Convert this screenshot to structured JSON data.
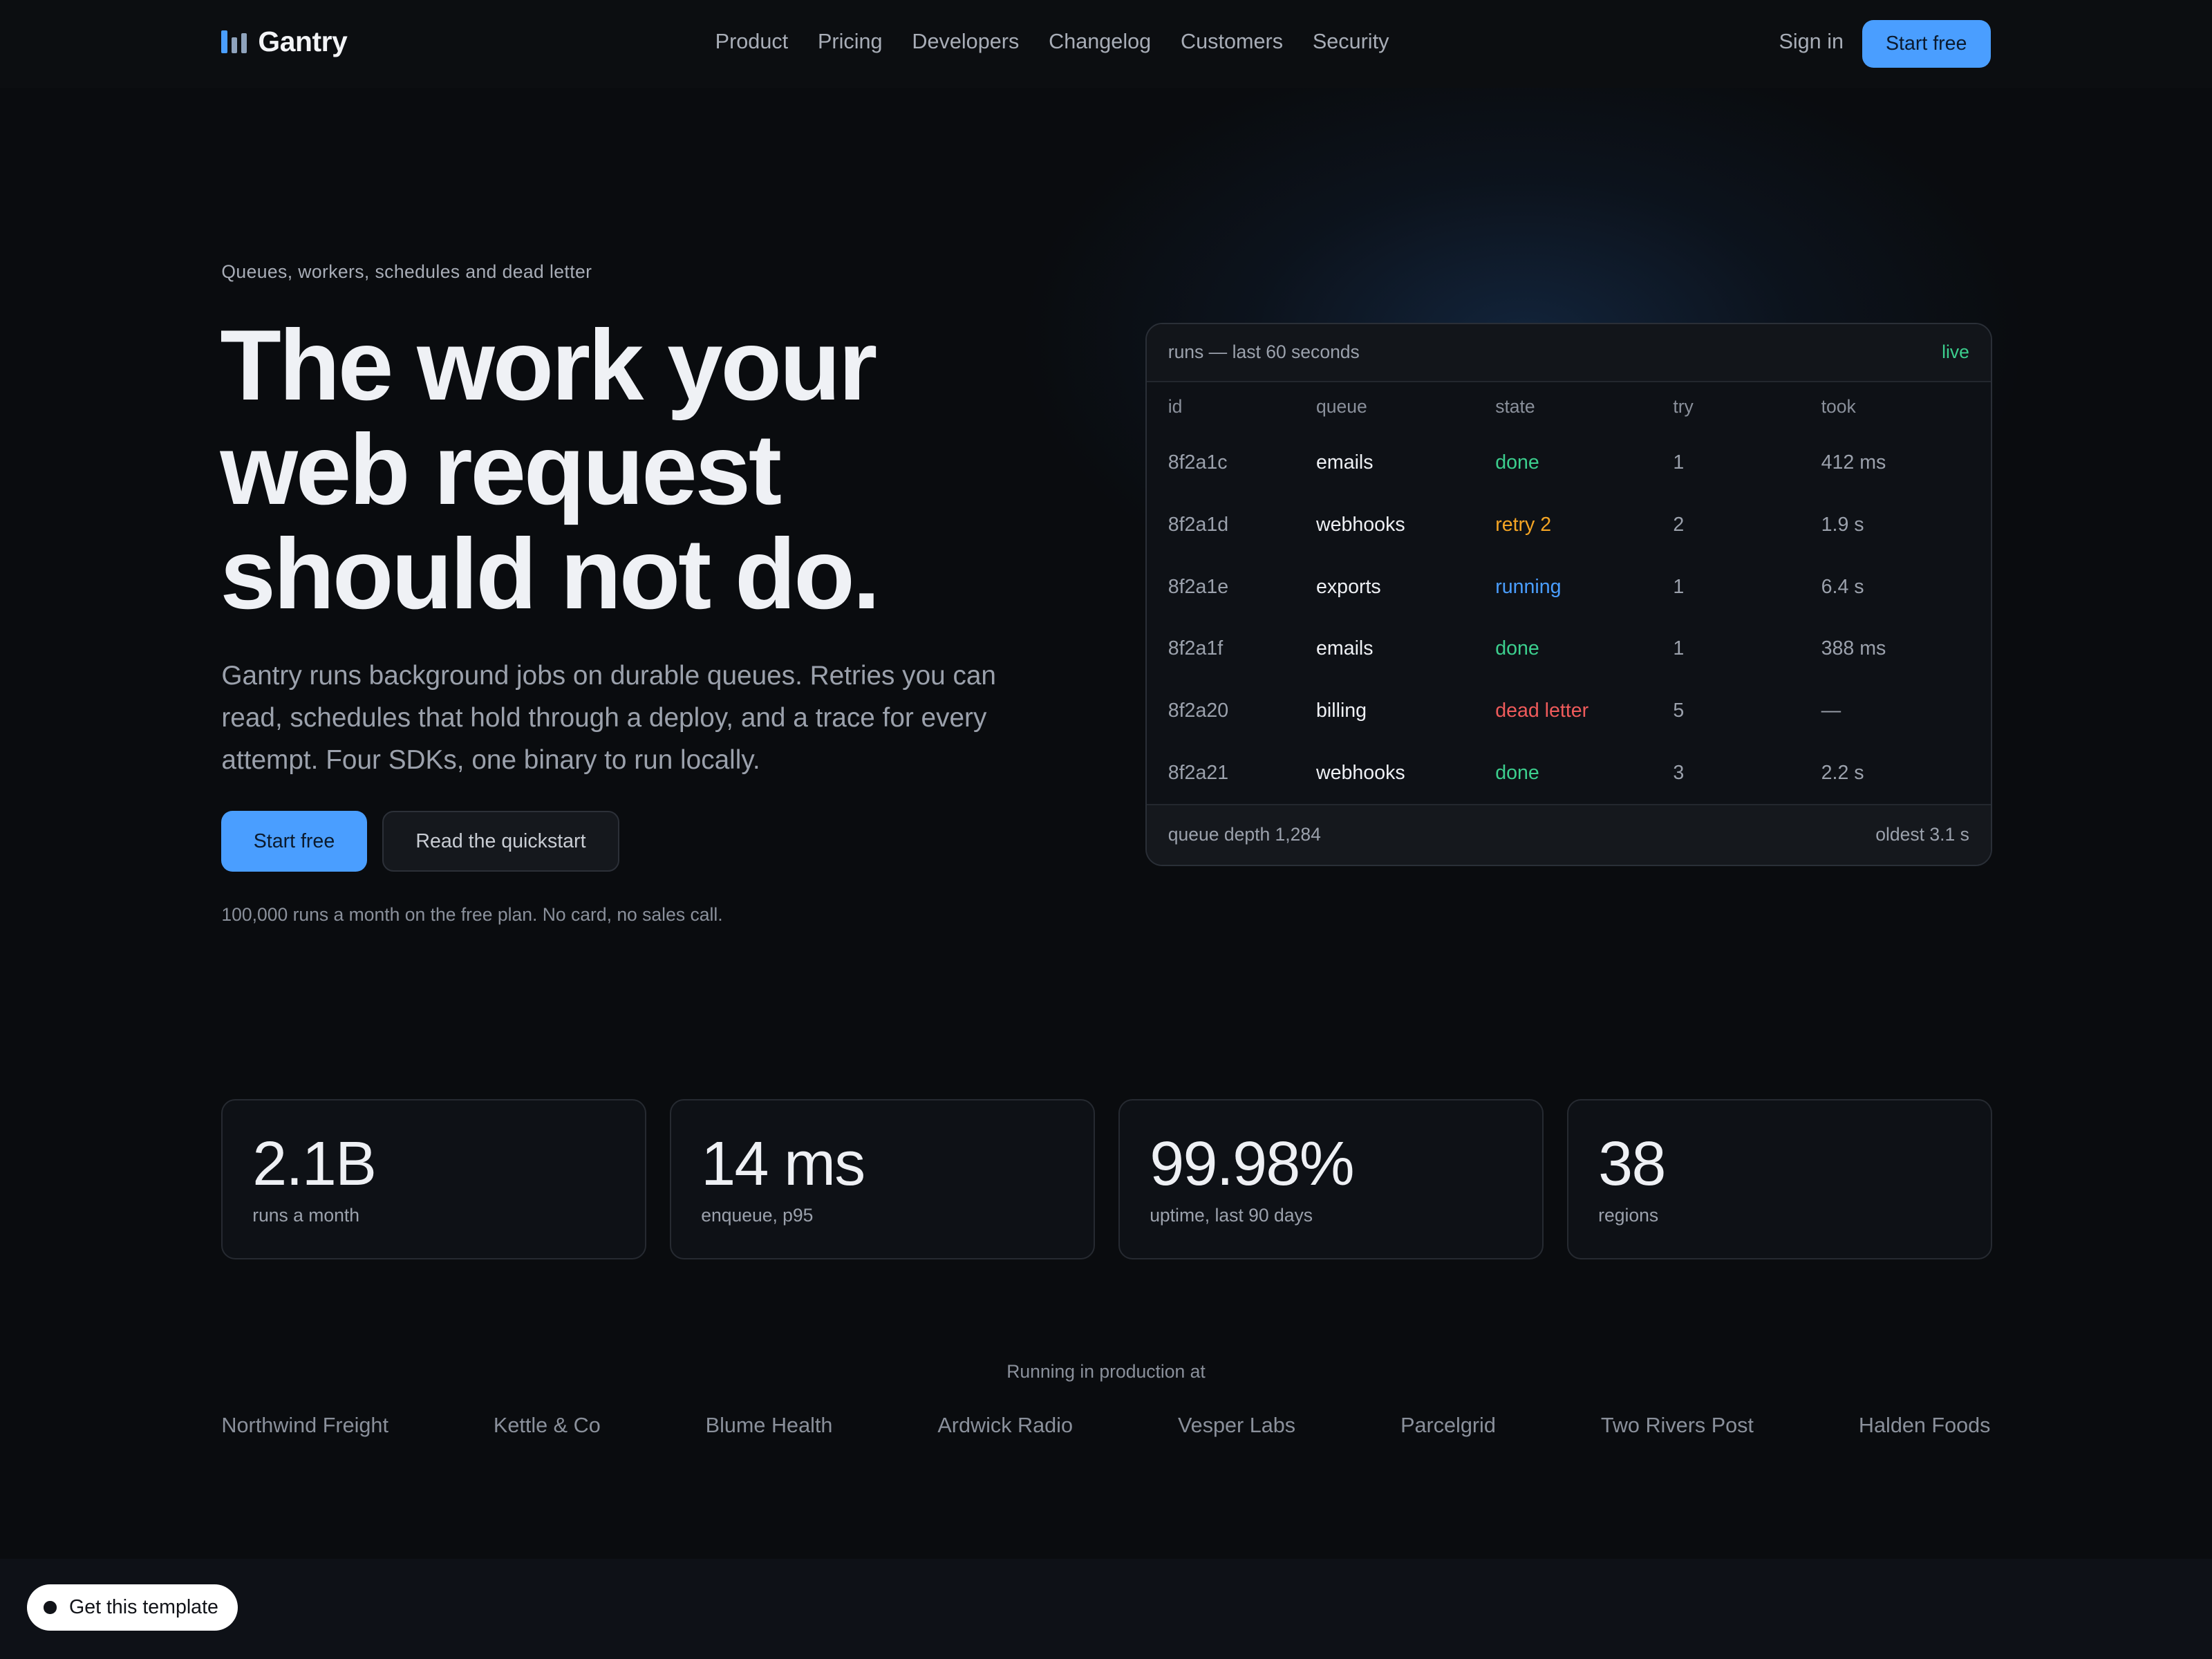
{
  "brand": {
    "name": "Gantry",
    "icon": "bar-chart-icon",
    "colors": {
      "accent": "#4a9eff",
      "background": "#0a0c0f",
      "done": "#3ccf8e",
      "retry": "#f5a524",
      "running": "#4a9eff",
      "dead_letter": "#ef5b5b"
    }
  },
  "nav": {
    "links": [
      "Product",
      "Pricing",
      "Developers",
      "Changelog",
      "Customers",
      "Security"
    ],
    "sign_in": "Sign in",
    "cta": "Start free"
  },
  "hero": {
    "eyebrow": "Queues, workers, schedules and dead letter",
    "headline": [
      "The work your",
      "web request",
      "should not do."
    ],
    "subtext": "Gantry runs background jobs on durable queues. Retries you can read, schedules that hold through a deploy, and a trace for every attempt. Four SDKs, one binary to run locally.",
    "primary_cta": "Start free",
    "secondary_cta": "Read the quickstart",
    "fineprint": "100,000 runs a month on the free plan. No card, no sales call."
  },
  "runs_panel": {
    "title": "runs — last 60 seconds",
    "status": "live",
    "columns": [
      "id",
      "queue",
      "state",
      "try",
      "took"
    ],
    "rows": [
      {
        "id": "8f2a1c",
        "queue": "emails",
        "state": "done",
        "state_kind": "done",
        "try": "1",
        "took": "412 ms"
      },
      {
        "id": "8f2a1d",
        "queue": "webhooks",
        "state": "retry 2",
        "state_kind": "retry",
        "try": "2",
        "took": "1.9 s"
      },
      {
        "id": "8f2a1e",
        "queue": "exports",
        "state": "running",
        "state_kind": "running",
        "try": "1",
        "took": "6.4 s"
      },
      {
        "id": "8f2a1f",
        "queue": "emails",
        "state": "done",
        "state_kind": "done",
        "try": "1",
        "took": "388 ms"
      },
      {
        "id": "8f2a20",
        "queue": "billing",
        "state": "dead letter",
        "state_kind": "dead_letter",
        "try": "5",
        "took": "—"
      },
      {
        "id": "8f2a21",
        "queue": "webhooks",
        "state": "done",
        "state_kind": "done",
        "try": "3",
        "took": "2.2 s"
      }
    ],
    "footer_left": "queue depth 1,284",
    "footer_right": "oldest 3.1 s"
  },
  "stats": [
    {
      "value": "2.1B",
      "label": "runs a month"
    },
    {
      "value": "14 ms",
      "label": "enqueue, p95"
    },
    {
      "value": "99.98%",
      "label": "uptime, last 90 days"
    },
    {
      "value": "38",
      "label": "regions"
    }
  ],
  "customers": {
    "heading": "Running in production at",
    "names": [
      "Northwind Freight",
      "Kettle & Co",
      "Blume Health",
      "Ardwick Radio",
      "Vesper Labs",
      "Parcelgrid",
      "Two Rivers Post",
      "Halden Foods"
    ]
  },
  "template_badge": {
    "label": "Get this template"
  }
}
